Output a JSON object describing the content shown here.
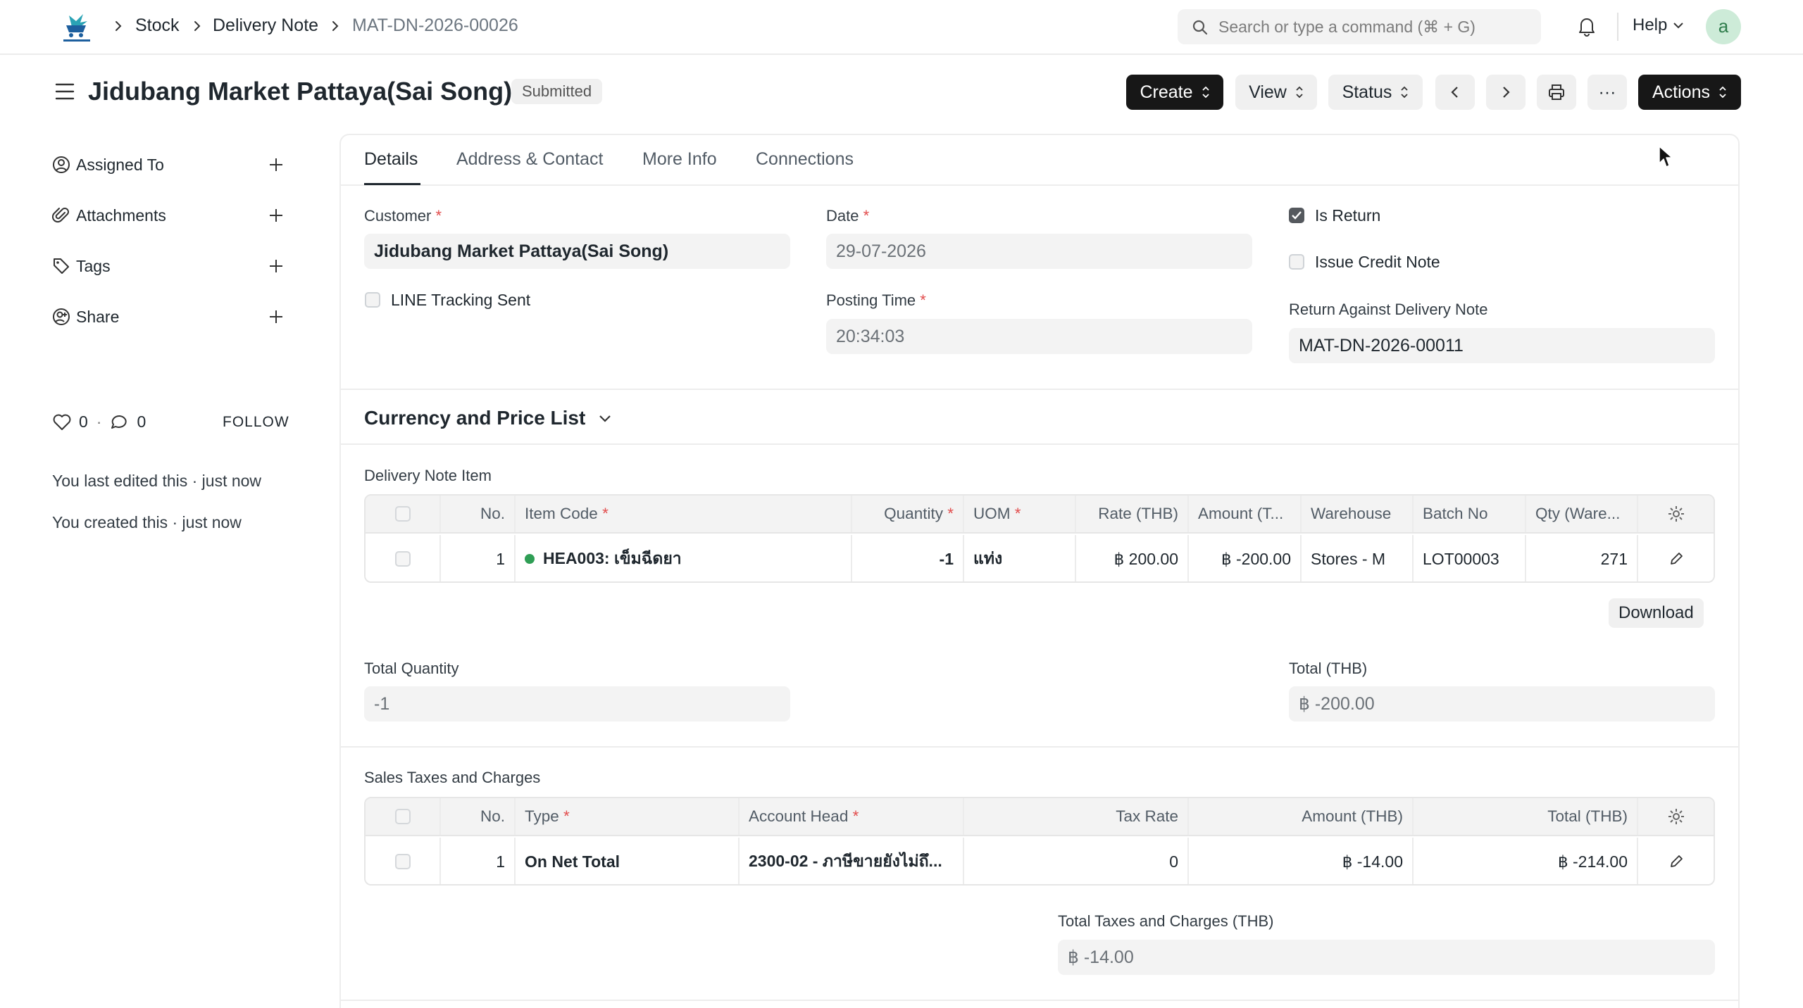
{
  "navbar": {
    "breadcrumbs": [
      "Stock",
      "Delivery Note",
      "MAT-DN-2026-00026"
    ],
    "search_placeholder": "Search or type a command (⌘ + G)",
    "help_label": "Help",
    "avatar_letter": "a"
  },
  "header": {
    "title": "Jidubang Market Pattaya(Sai Song)",
    "status": "Submitted",
    "buttons": {
      "create": "Create",
      "view": "View",
      "status": "Status",
      "actions": "Actions",
      "more": "···"
    }
  },
  "sidebar": {
    "items": [
      {
        "label": "Assigned To",
        "icon": "assign-icon"
      },
      {
        "label": "Attachments",
        "icon": "paperclip-icon"
      },
      {
        "label": "Tags",
        "icon": "tag-icon"
      },
      {
        "label": "Share",
        "icon": "share-icon"
      }
    ],
    "likes": "0",
    "comments": "0",
    "follow_label": "FOLLOW",
    "activity": [
      "You last edited this · just now",
      "You created this · just now"
    ]
  },
  "tabs": [
    "Details",
    "Address & Contact",
    "More Info",
    "Connections"
  ],
  "details": {
    "customer_label": "Customer",
    "customer_value": "Jidubang Market Pattaya(Sai Song)",
    "date_label": "Date",
    "date_value": "29-07-2026",
    "posting_time_label": "Posting Time",
    "posting_time_value": "20:34:03",
    "line_tracking_label": "LINE Tracking Sent",
    "line_tracking_checked": false,
    "is_return_label": "Is Return",
    "is_return_checked": true,
    "issue_credit_label": "Issue Credit Note",
    "issue_credit_checked": false,
    "return_against_label": "Return Against Delivery Note",
    "return_against_value": "MAT-DN-2026-00011"
  },
  "currency_section": {
    "title": "Currency and Price List"
  },
  "items_table": {
    "title": "Delivery Note Item",
    "columns": [
      "No.",
      "Item Code",
      "Quantity",
      "UOM",
      "Rate (THB)",
      "Amount (T...",
      "Warehouse",
      "Batch No",
      "Qty (Ware..."
    ],
    "rows": [
      {
        "no": "1",
        "item_code": "HEA003: เข็มฉีดยา",
        "quantity": "-1",
        "uom": "แท่ง",
        "rate": "฿ 200.00",
        "amount": "฿ -200.00",
        "warehouse": "Stores - M",
        "batch_no": "LOT00003",
        "qty_warehouse": "271"
      }
    ],
    "download_label": "Download"
  },
  "totals": {
    "total_quantity_label": "Total Quantity",
    "total_quantity_value": "-1",
    "total_label": "Total (THB)",
    "total_value": "฿ -200.00"
  },
  "taxes_table": {
    "title": "Sales Taxes and Charges",
    "columns": [
      "No.",
      "Type",
      "Account Head",
      "Tax Rate",
      "Amount (THB)",
      "Total (THB)"
    ],
    "rows": [
      {
        "no": "1",
        "type": "On Net Total",
        "account_head": "2300-02 - ภาษีขายยังไม่ถึ...",
        "tax_rate": "0",
        "amount": "฿ -14.00",
        "total": "฿ -214.00"
      }
    ],
    "total_taxes_label": "Total Taxes and Charges (THB)",
    "total_taxes_value": "฿ -14.00"
  },
  "colors": {
    "primary_button": "#171717",
    "checkbox_checked": "#55595e",
    "item_indicator": "#2f9e55",
    "required_mark": "#e24c4c"
  }
}
